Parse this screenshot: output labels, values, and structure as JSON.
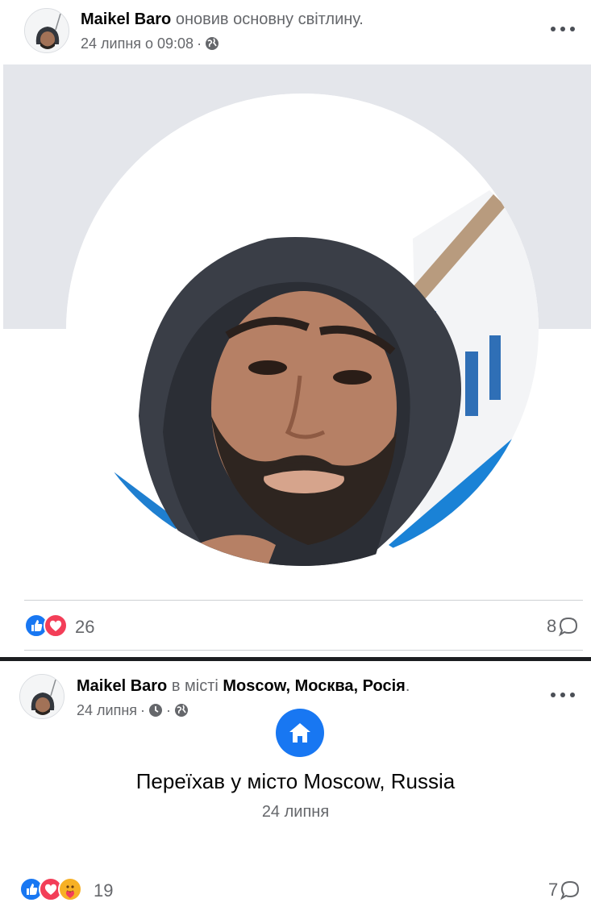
{
  "post1": {
    "author": "Maikel Baro",
    "action": "оновив основну світлину.",
    "timestamp": "24 липня о 09:08",
    "meta_separator": "·",
    "privacy_icon": "globe-icon",
    "reactions": [
      "like",
      "love"
    ],
    "reaction_count": "26",
    "comment_count": "8"
  },
  "post2": {
    "author": "Maikel Baro",
    "location_prefix": "в місті",
    "location": "Moscow, Москва, Росія",
    "trailing_period": ".",
    "timestamp": "24 липня",
    "meta_separator": "·",
    "clock_icon": "clock-icon",
    "privacy_icon": "globe-icon",
    "event_icon": "home-icon",
    "event_title": "Переїхав у місто Moscow, Russia",
    "event_date": "24 липня",
    "reactions": [
      "like",
      "love",
      "care"
    ],
    "reaction_count": "19",
    "comment_count": "7"
  },
  "colors": {
    "accent": "#1877f2",
    "love": "#f33e58",
    "care": "#f7b125",
    "secondary_text": "#65676b",
    "cover_gray": "#e4e6eb"
  }
}
